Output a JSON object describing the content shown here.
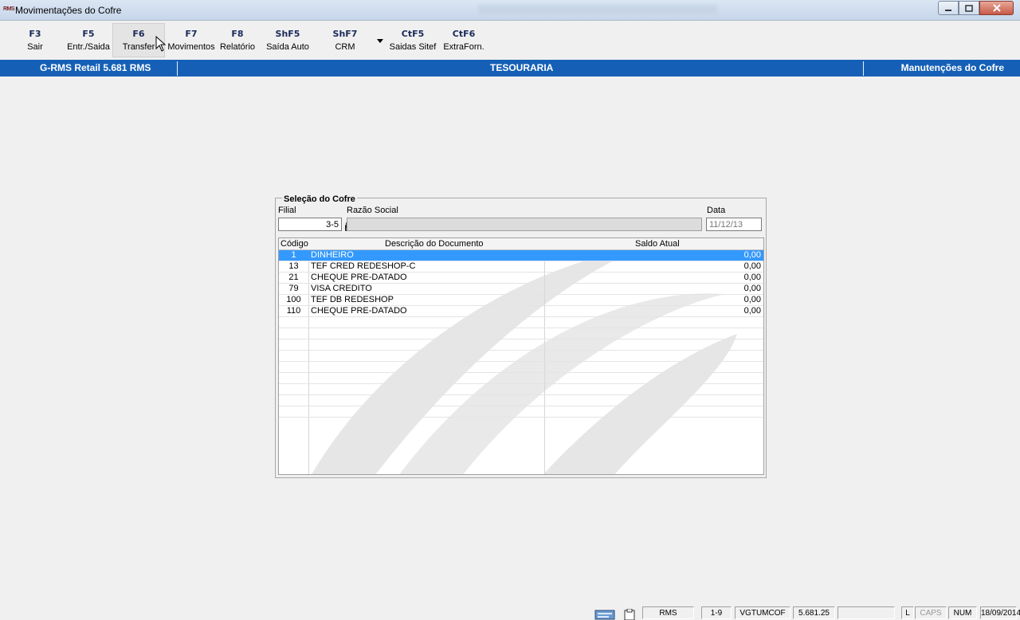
{
  "window": {
    "title": "Movimentações do Cofre",
    "app_icon_text": "RMS"
  },
  "toolbar": {
    "items": [
      {
        "key": "F3",
        "label": "Sair"
      },
      {
        "key": "F5",
        "label": "Entr./Saida"
      },
      {
        "key": "F6",
        "label": "Transfer"
      },
      {
        "key": "F7",
        "label": "Movimentos"
      },
      {
        "key": "F8",
        "label": "Relatório"
      },
      {
        "key": "ShF5",
        "label": "Saída Auto"
      },
      {
        "key": "ShF7",
        "label": "CRM"
      },
      {
        "key": "CtF5",
        "label": "Saidas Sitef"
      },
      {
        "key": "CtF6",
        "label": "ExtraForn."
      }
    ]
  },
  "header": {
    "left": "G-RMS Retail 5.681 RMS",
    "center": "TESOURARIA",
    "right": "Manutenções do Cofre"
  },
  "panel": {
    "legend": "Seleção do Cofre",
    "filial_label": "Filial",
    "filial_value": "3-5",
    "razao_label": "Razão Social",
    "razao_value": "",
    "data_label": "Data",
    "data_value": "11/12/13",
    "columns": [
      "Código",
      "Descrição do Documento",
      "Saldo Atual"
    ],
    "rows": [
      {
        "codigo": "1",
        "descricao": "DINHEIRO",
        "saldo": "0,00",
        "selected": true
      },
      {
        "codigo": "13",
        "descricao": "TEF CRED REDESHOP-C",
        "saldo": "0,00",
        "selected": false
      },
      {
        "codigo": "21",
        "descricao": "CHEQUE PRE-DATADO",
        "saldo": "0,00",
        "selected": false
      },
      {
        "codigo": "79",
        "descricao": "VISA CREDITO",
        "saldo": "0,00",
        "selected": false
      },
      {
        "codigo": "100",
        "descricao": "TEF DB REDESHOP",
        "saldo": "0,00",
        "selected": false
      },
      {
        "codigo": "110",
        "descricao": "CHEQUE PRE-DATADO",
        "saldo": "0,00",
        "selected": false
      }
    ]
  },
  "statusbar": {
    "user": "RMS",
    "range": "1-9",
    "program": "VGTUMCOF",
    "version": "5.681.25",
    "l": "L",
    "caps": "CAPS",
    "num": "NUM",
    "date": "18/09/2014"
  },
  "colors": {
    "header_bar": "#1560b6",
    "selection": "#3399ff"
  }
}
